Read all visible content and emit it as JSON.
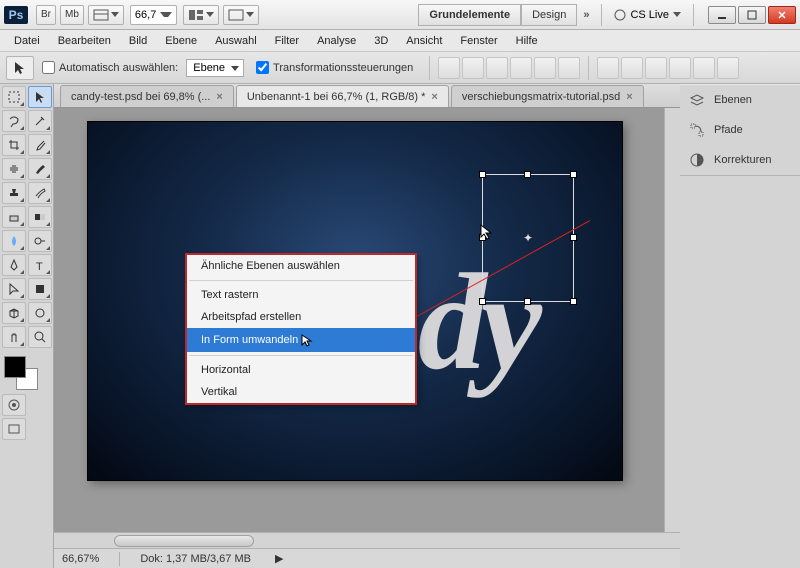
{
  "title_bar": {
    "ps_label": "Ps",
    "br_label": "Br",
    "mb_label": "Mb",
    "zoom_value": "66,7",
    "workspace_active": "Grundelemente",
    "workspace_other": "Design",
    "cslive": "CS Live"
  },
  "menu": [
    "Datei",
    "Bearbeiten",
    "Bild",
    "Ebene",
    "Auswahl",
    "Filter",
    "Analyse",
    "3D",
    "Ansicht",
    "Fenster",
    "Hilfe"
  ],
  "options": {
    "auto_select_label": "Automatisch auswählen:",
    "auto_select_target": "Ebene",
    "transform_label": "Transformationssteuerungen",
    "auto_select_checked": false,
    "transform_checked": true
  },
  "tabs": [
    {
      "label": "candy-test.psd bei 69,8% (...",
      "active": false,
      "closeable": true
    },
    {
      "label": "Unbenannt-1 bei 66,7% (1, RGB/8) *",
      "active": true,
      "closeable": true
    },
    {
      "label": "verschiebungsmatrix-tutorial.psd",
      "active": false,
      "closeable": true
    }
  ],
  "canvas": {
    "text": "Candy"
  },
  "context_menu": {
    "items": [
      {
        "label": "Ähnliche Ebenen auswählen"
      },
      {
        "sep": true
      },
      {
        "label": "Text rastern"
      },
      {
        "label": "Arbeitspfad erstellen"
      },
      {
        "label": "In Form umwandeln",
        "highlight": true
      },
      {
        "sep": true
      },
      {
        "label": "Horizontal"
      },
      {
        "label": "Vertikal"
      }
    ]
  },
  "status": {
    "zoom": "66,67%",
    "docinfo": "Dok: 1,37 MB/3,67 MB"
  },
  "panels": [
    {
      "label": "Ebenen",
      "icon": "layers"
    },
    {
      "label": "Pfade",
      "icon": "paths"
    },
    {
      "label": "Korrekturen",
      "icon": "adjust"
    }
  ]
}
